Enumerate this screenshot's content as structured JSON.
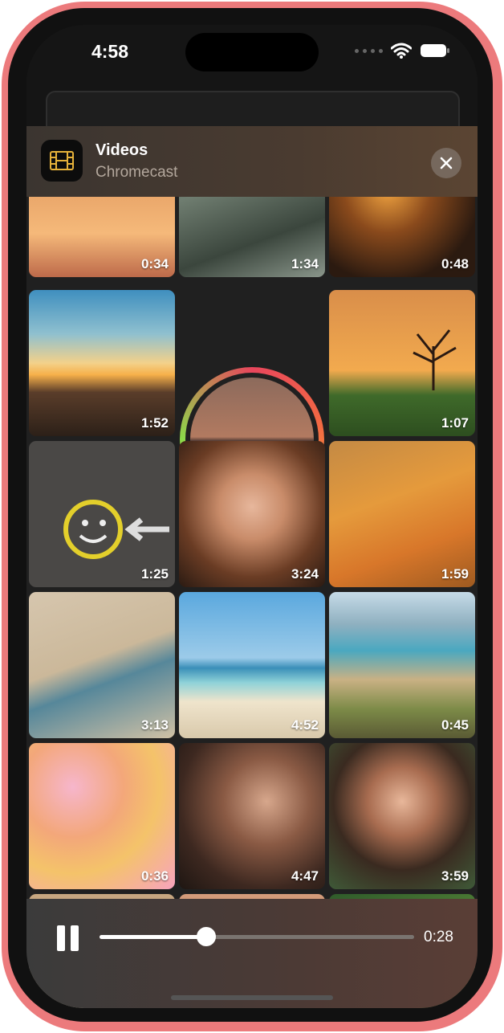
{
  "status": {
    "time": "4:58"
  },
  "header": {
    "title": "Videos",
    "subtitle": "Chromecast",
    "app_icon": "film-icon",
    "close_icon": "close-icon"
  },
  "videos": [
    {
      "duration": "0:34",
      "desc": "sunset clouds"
    },
    {
      "duration": "1:34",
      "desc": "green grass field"
    },
    {
      "duration": "0:48",
      "desc": "golden grass backlit"
    },
    {
      "duration": "1:52",
      "desc": "sunset over hills"
    },
    {
      "duration": "",
      "desc": "lake island sunset (selected)"
    },
    {
      "duration": "1:07",
      "desc": "lone tree on hill"
    },
    {
      "duration": "1:25",
      "desc": "smiley face chalk"
    },
    {
      "duration": "3:24",
      "desc": "freckled woman smiling"
    },
    {
      "duration": "1:59",
      "desc": "monarch butterfly"
    },
    {
      "duration": "3:13",
      "desc": "beach picnic"
    },
    {
      "duration": "4:52",
      "desc": "person reading on beach"
    },
    {
      "duration": "0:45",
      "desc": "hikers on coast"
    },
    {
      "duration": "0:36",
      "desc": "smiley balloons"
    },
    {
      "duration": "4:47",
      "desc": "woman laughing"
    },
    {
      "duration": "3:59",
      "desc": "woman smiling"
    }
  ],
  "player": {
    "elapsed": "0:28",
    "progress": 0.34,
    "pause_icon": "pause-icon"
  },
  "colors": {
    "frame": "#ec7a7c",
    "ring_start": "#e8465c",
    "ring_end": "#8bd94a"
  }
}
